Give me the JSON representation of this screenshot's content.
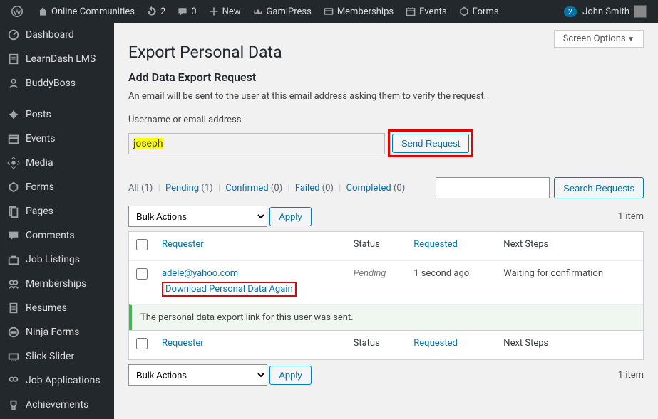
{
  "adminbar": {
    "site_name": "Online Communities",
    "updates_count": "2",
    "comments_count": "0",
    "new_label": "New",
    "items": [
      "GamiPress",
      "Memberships",
      "Events",
      "Forms"
    ],
    "user_notif": "2",
    "user_name": "John Smith"
  },
  "sidebar": {
    "items": [
      "Dashboard",
      "LearnDash LMS",
      "BuddyBoss",
      "Posts",
      "Events",
      "Media",
      "Forms",
      "Pages",
      "Comments",
      "Job Listings",
      "Memberships",
      "Resumes",
      "Ninja Forms",
      "Slick Slider",
      "Job Applications",
      "Achievements"
    ]
  },
  "screen_options_label": "Screen Options",
  "page_title": "Export Personal Data",
  "section_title": "Add Data Export Request",
  "section_desc": "An email will be sent to the user at this email address asking them to verify the request.",
  "field_label": "Username or email address",
  "input_value": "joseph",
  "send_request_label": "Send Request",
  "filters": {
    "all": "All",
    "all_count": "(1)",
    "pending": "Pending",
    "pending_count": "(1)",
    "confirmed": "Confirmed",
    "confirmed_count": "(0)",
    "failed": "Failed",
    "failed_count": "(0)",
    "completed": "Completed",
    "completed_count": "(0)"
  },
  "search_button": "Search Requests",
  "bulk_actions_label": "Bulk Actions",
  "apply_label": "Apply",
  "items_count_label": "1 item",
  "columns": {
    "requester": "Requester",
    "status": "Status",
    "requested": "Requested",
    "next_steps": "Next Steps"
  },
  "row": {
    "requester": "adele@yahoo.com",
    "row_action": "Download Personal Data Again",
    "status": "Pending",
    "requested": "1 second ago",
    "next_steps": "Waiting for confirmation"
  },
  "notice_text": "The personal data export link for this user was sent."
}
